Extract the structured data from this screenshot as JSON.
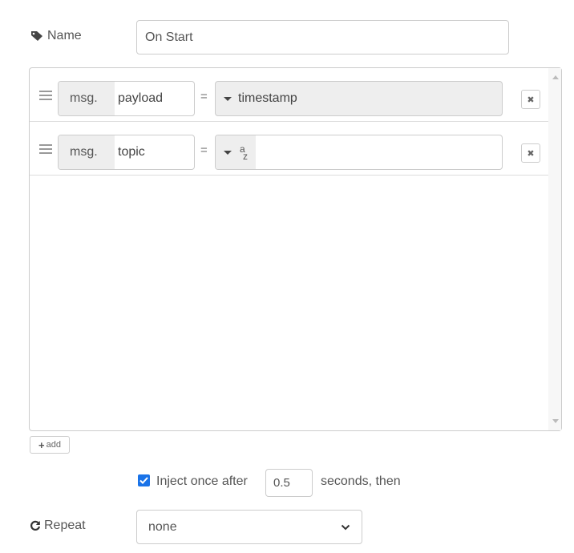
{
  "name_field": {
    "label": "Name",
    "value": "On Start"
  },
  "properties": [
    {
      "prefix": "msg.",
      "field": "payload",
      "operator": "=",
      "type_icon": "caret-down",
      "value": "timestamp"
    },
    {
      "prefix": "msg.",
      "field": "topic",
      "operator": "=",
      "type_icon": "string-type-az",
      "type_glyph_top": "a",
      "type_glyph_bottom": "z",
      "value": ""
    }
  ],
  "add_button": {
    "label": "add"
  },
  "inject_once": {
    "checked": true,
    "label": "Inject once after",
    "delay": "0.5",
    "suffix": "seconds, then"
  },
  "repeat": {
    "label": "Repeat",
    "selected": "none"
  },
  "colors": {
    "checkbox": "#1a73e8",
    "field_bg": "#eeeeee",
    "border": "#cccccc"
  }
}
